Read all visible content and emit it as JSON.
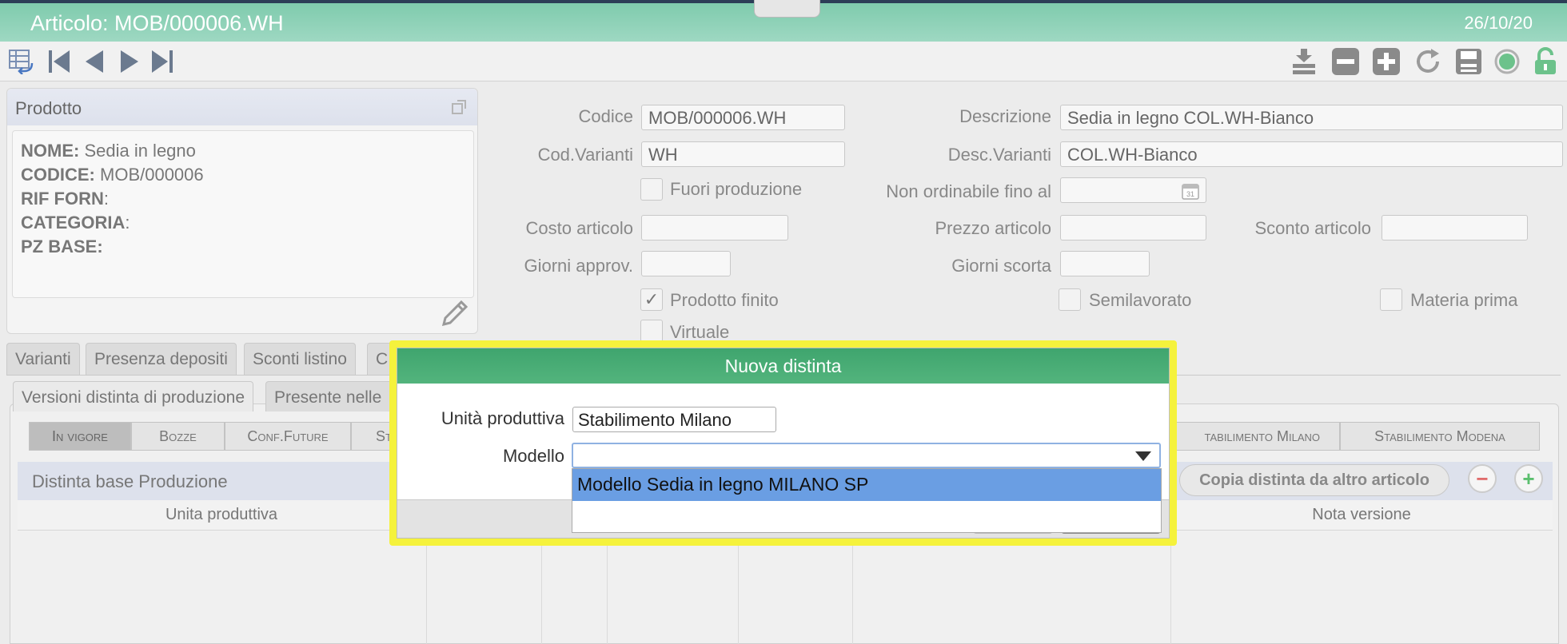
{
  "window": {
    "title": "Articolo: MOB/000006.WH",
    "date": "26/10/20"
  },
  "toolbar": {
    "left_icons": [
      "table-back-icon",
      "first-record-icon",
      "previous-record-icon",
      "next-record-icon",
      "last-record-icon"
    ],
    "right_icons": [
      "download-icon",
      "remove-icon",
      "add-icon",
      "refresh-icon",
      "save-icon",
      "status-dot-icon",
      "unlock-icon"
    ]
  },
  "prodotto": {
    "title": "Prodotto",
    "lines": [
      {
        "key": "NOME:",
        "value": " Sedia in legno"
      },
      {
        "key": "CODICE:",
        "value": " MOB/000006"
      },
      {
        "key": "RIF FORN",
        "value": ":"
      },
      {
        "key": "CATEGORIA",
        "value": ":"
      },
      {
        "key": "PZ BASE:",
        "value": ""
      }
    ]
  },
  "form": {
    "codice_label": "Codice",
    "codice_value": "MOB/000006.WH",
    "descrizione_label": "Descrizione",
    "descrizione_value": "Sedia in legno COL.WH-Bianco",
    "cod_varianti_label": "Cod.Varianti",
    "cod_varianti_value": "WH",
    "desc_varianti_label": "Desc.Varianti",
    "desc_varianti_value": "COL.WH-Bianco",
    "fuori_produzione_label": "Fuori produzione",
    "non_ordinabile_label": "Non ordinabile fino al",
    "costo_label": "Costo articolo",
    "prezzo_label": "Prezzo articolo",
    "sconto_label": "Sconto articolo",
    "giorni_approv_label": "Giorni approv.",
    "giorni_scorta_label": "Giorni scorta",
    "prodotto_finito_label": "Prodotto finito",
    "semilavorato_label": "Semilavorato",
    "materia_prima_label": "Materia prima",
    "virtuale_label": "Virtuale"
  },
  "tabs": [
    "Varianti",
    "Presenza depositi",
    "Sconti listino",
    "C"
  ],
  "subtabs": [
    "Versioni distinta di produzione",
    "Presente nelle"
  ],
  "filters": {
    "in_vigore": "In vigore",
    "bozze": "Bozze",
    "conf_future": "Conf.Future",
    "st": "St",
    "milano": "tabilimento Milano",
    "modena": "Stabilimento Modena"
  },
  "distinta": {
    "title": "Distinta base Produzione",
    "copy_button": "Copia distinta da altro articolo",
    "col_unita": "Unita produttiva",
    "col_nota": "Nota versione"
  },
  "dialog": {
    "title": "Nuova distinta",
    "unita_label": "Unità produttiva",
    "unita_value": "Stabilimento Milano",
    "modello_label": "Modello",
    "modello_value": "",
    "options": [
      "Modello Sedia in legno MILANO SP",
      ""
    ]
  },
  "colors": {
    "title_green": "#8fd2b8",
    "dialog_green": "#47aa74",
    "highlight_border": "#f5f23c",
    "option_highlight": "#6a9ee3"
  }
}
